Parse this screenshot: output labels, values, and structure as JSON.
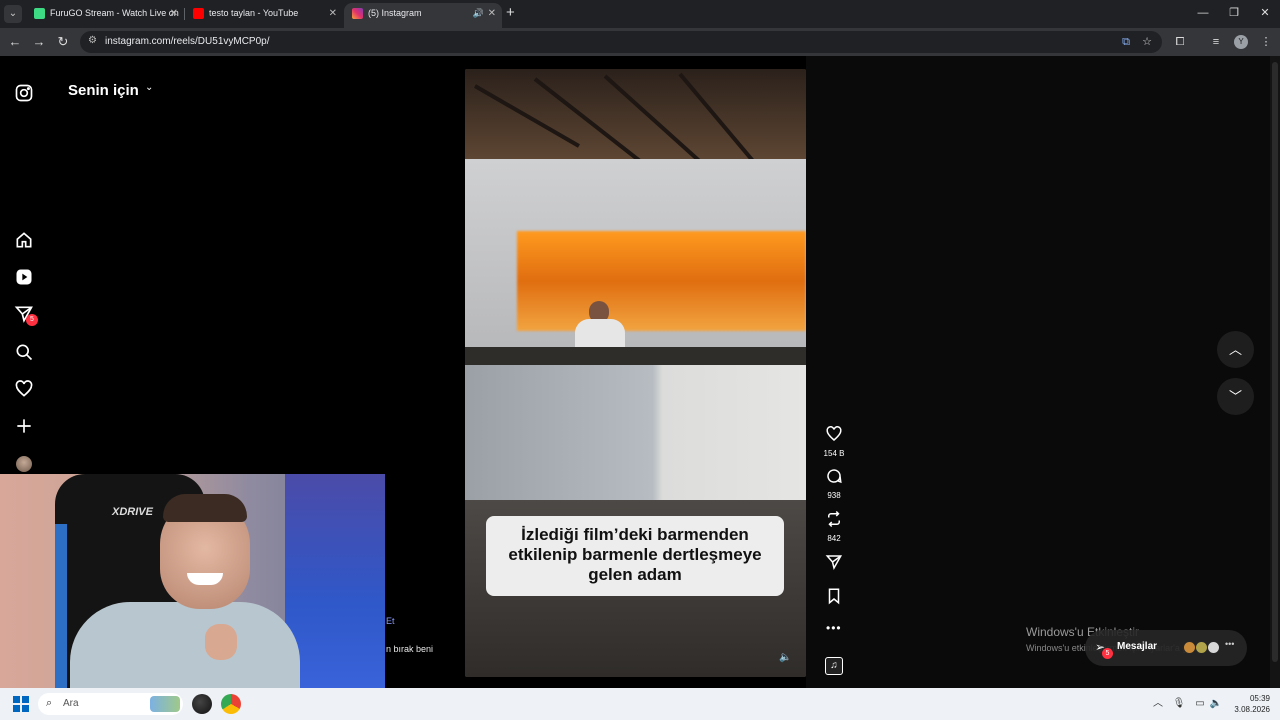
{
  "browser": {
    "tabs": [
      {
        "title": "FuruGO Stream - Watch Live on",
        "favicon_color": "#3ddc84",
        "active": false
      },
      {
        "title": "testo taylan - YouTube",
        "favicon_color": "#ff0000",
        "active": false
      },
      {
        "title": "(5) Instagram",
        "favicon_color": "#e1306c",
        "active": true
      }
    ],
    "url": "instagram.com/reels/DU51vyMCP0p/",
    "profile_initial": "Y"
  },
  "instagram": {
    "feed_title": "Senin için",
    "notifications_badge": "5",
    "caption": "İzlediği film’deki barmenden etkilenip barmenle dertleşmeye gelen adam",
    "actions": {
      "likes": "154 B",
      "comments": "938",
      "reposts": "842"
    },
    "partial_text": {
      "follow_fragment": "Et",
      "caption_fragment": "n bırak beni"
    },
    "messages": {
      "label": "Mesajlar",
      "badge": "5"
    }
  },
  "webcam": {
    "chair_brand": "XDRIVE"
  },
  "windows": {
    "activation_title": "Windows'u Etkinleştir",
    "activation_sub": "Windows'u etkinleştirmek için Ayarlar'a gidin.",
    "search_placeholder": "Ara",
    "time": "05:39",
    "date": "3.08.2026"
  },
  "colors": {
    "accent_badge": "#ff3040",
    "windows_blue": "#0067c0"
  }
}
